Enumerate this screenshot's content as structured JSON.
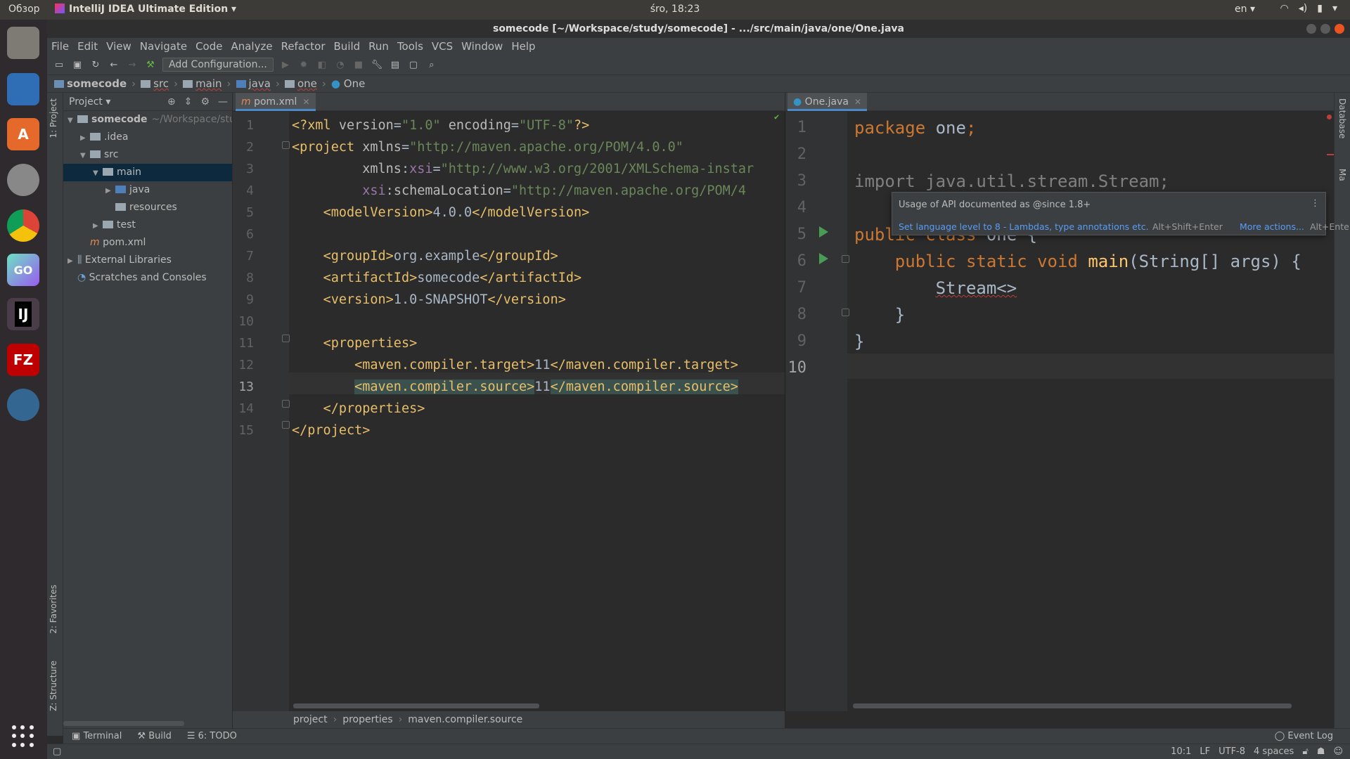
{
  "system": {
    "overview": "Обзор",
    "app_name": "IntelliJ IDEA Ultimate Edition",
    "clock": "śro, 18:23",
    "lang": "en"
  },
  "dock": {
    "apps": [
      {
        "name": "files-app-icon",
        "label": ""
      },
      {
        "name": "libreoffice-writer-icon",
        "label": ""
      },
      {
        "name": "software-center-icon",
        "label": "A"
      },
      {
        "name": "settings-app-icon",
        "label": ""
      },
      {
        "name": "chrome-app-icon",
        "label": ""
      },
      {
        "name": "goland-app-icon",
        "label": "GO"
      },
      {
        "name": "intellij-app-icon",
        "label": "IJ"
      },
      {
        "name": "filezilla-app-icon",
        "label": "FZ"
      },
      {
        "name": "postgres-app-icon",
        "label": ""
      }
    ]
  },
  "window": {
    "title": "somecode [~/Workspace/study/somecode] - .../src/main/java/one/One.java"
  },
  "menu": [
    "File",
    "Edit",
    "View",
    "Navigate",
    "Code",
    "Analyze",
    "Refactor",
    "Build",
    "Run",
    "Tools",
    "VCS",
    "Window",
    "Help"
  ],
  "toolbar": {
    "add_configuration": "Add Configuration..."
  },
  "navbar": {
    "items": [
      "somecode",
      "src",
      "main",
      "java",
      "one",
      "One"
    ]
  },
  "side_tabs": {
    "project": "1: Project",
    "favorites": "2: Favorites",
    "structure": "Z: Structure",
    "database": "Database",
    "maven": "Ma"
  },
  "project_panel": {
    "title": "Project",
    "tree": [
      {
        "label": "somecode",
        "hint": "~/Workspace/stuc",
        "depth": 0,
        "arrow": "▼",
        "bold": true
      },
      {
        "label": ".idea",
        "depth": 1,
        "arrow": "▶"
      },
      {
        "label": "src",
        "depth": 1,
        "arrow": "▼"
      },
      {
        "label": "main",
        "depth": 2,
        "arrow": "▼",
        "selected": true
      },
      {
        "label": "java",
        "depth": 3,
        "arrow": "▶",
        "blue": true
      },
      {
        "label": "resources",
        "depth": 3,
        "arrow": ""
      },
      {
        "label": "test",
        "depth": 2,
        "arrow": "▶"
      },
      {
        "label": "pom.xml",
        "depth": 1,
        "arrow": "",
        "file": "m"
      },
      {
        "label": "External Libraries",
        "depth": 0,
        "arrow": "▶",
        "lib": true
      },
      {
        "label": "Scratches and Consoles",
        "depth": 0,
        "arrow": "",
        "scratch": true
      }
    ]
  },
  "left_editor": {
    "tab": "pom.xml",
    "line_numbers": [
      "1",
      "2",
      "3",
      "4",
      "5",
      "6",
      "7",
      "8",
      "9",
      "10",
      "11",
      "12",
      "13",
      "14",
      "15"
    ],
    "current_line": "13",
    "breadcrumbs": [
      "project",
      "properties",
      "maven.compiler.source"
    ]
  },
  "right_editor": {
    "tab": "One.java",
    "line_numbers": [
      "1",
      "2",
      "3",
      "4",
      "5",
      "6",
      "7",
      "8",
      "9",
      "10"
    ],
    "current_line": "10"
  },
  "popup": {
    "message": "Usage of API documented as @since 1.8+",
    "fix": "Set language level to 8 - Lambdas, type annotations etc.",
    "fix_shortcut": "Alt+Shift+Enter",
    "more": "More actions...",
    "more_shortcut": "Alt+Ente"
  },
  "bottom_tabs": {
    "terminal": "Terminal",
    "build": "Build",
    "todo": "6: TODO",
    "event_log": "Event Log"
  },
  "status": {
    "position": "10:1",
    "line_sep": "LF",
    "encoding": "UTF-8",
    "indent": "4 spaces"
  },
  "colors": {
    "accent": "#4a88c7",
    "run_green": "#499c54",
    "selection": "#0d293e"
  }
}
